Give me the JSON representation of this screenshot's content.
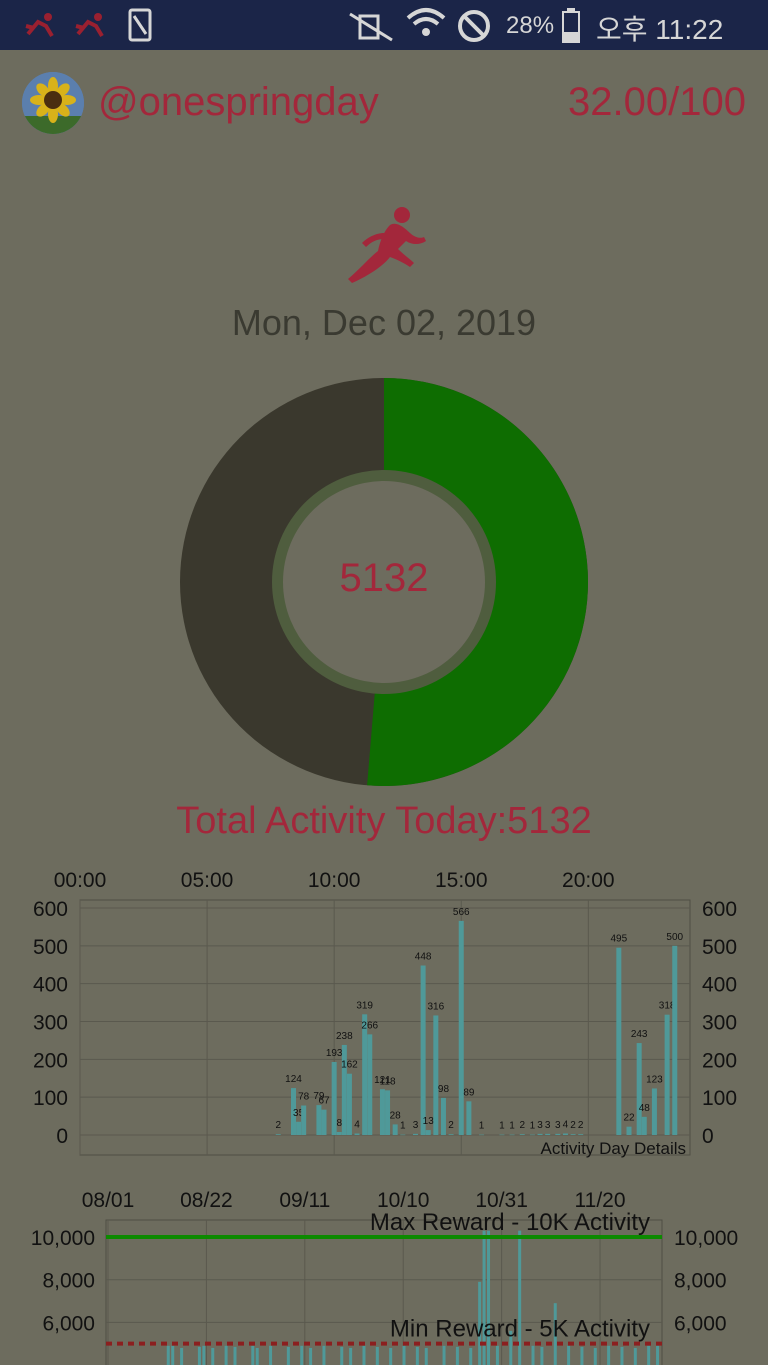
{
  "status_bar": {
    "battery": "28%",
    "time": "오후 11:22"
  },
  "profile": {
    "username": "@onespringday",
    "score": "32.00/100"
  },
  "date": "Mon, Dec 02, 2019",
  "donut": {
    "center_value": "5132",
    "activity": 5132,
    "goal": 10000,
    "colors": {
      "progress": "#0e6d01",
      "remaining": "#3a382d",
      "ring": "#4f5d3e"
    }
  },
  "total_label": "Total Activity Today:5132",
  "chart_data": [
    {
      "type": "bar",
      "caption": "Activity Day Details",
      "top_axis_labels": [
        "00:00",
        "05:00",
        "10:00",
        "15:00",
        "20:00"
      ],
      "y_ticks": [
        "0",
        "100",
        "200",
        "300",
        "400",
        "500",
        "600"
      ],
      "ylim": [
        0,
        600
      ],
      "bar_color": "#4f9999",
      "bars": [
        {
          "t": 7.8,
          "v": 2,
          "l": "2"
        },
        {
          "t": 8.4,
          "v": 124,
          "l": "124"
        },
        {
          "t": 8.6,
          "v": 35,
          "l": "35"
        },
        {
          "t": 8.8,
          "v": 78,
          "l": "78"
        },
        {
          "t": 9.4,
          "v": 79,
          "l": "79"
        },
        {
          "t": 9.6,
          "v": 67,
          "l": "67"
        },
        {
          "t": 10.0,
          "v": 193,
          "l": "193"
        },
        {
          "t": 10.2,
          "v": 8,
          "l": "8"
        },
        {
          "t": 10.4,
          "v": 238,
          "l": "238"
        },
        {
          "t": 10.6,
          "v": 162,
          "l": "162"
        },
        {
          "t": 10.9,
          "v": 4,
          "l": "4"
        },
        {
          "t": 11.2,
          "v": 319,
          "l": "319"
        },
        {
          "t": 11.4,
          "v": 266,
          "l": "266"
        },
        {
          "t": 11.9,
          "v": 121,
          "l": "121"
        },
        {
          "t": 12.1,
          "v": 118,
          "l": "118"
        },
        {
          "t": 12.4,
          "v": 28,
          "l": "28"
        },
        {
          "t": 12.7,
          "v": 1,
          "l": "1"
        },
        {
          "t": 13.2,
          "v": 3,
          "l": "3"
        },
        {
          "t": 13.5,
          "v": 448,
          "l": "448"
        },
        {
          "t": 13.7,
          "v": 13,
          "l": "13"
        },
        {
          "t": 14.0,
          "v": 316,
          "l": "316"
        },
        {
          "t": 14.3,
          "v": 98,
          "l": "98"
        },
        {
          "t": 14.6,
          "v": 2,
          "l": "2"
        },
        {
          "t": 15.0,
          "v": 566,
          "l": "566"
        },
        {
          "t": 15.3,
          "v": 89,
          "l": "89"
        },
        {
          "t": 15.8,
          "v": 1,
          "l": "1"
        },
        {
          "t": 16.6,
          "v": 1,
          "l": "1"
        },
        {
          "t": 17.0,
          "v": 1,
          "l": "1"
        },
        {
          "t": 17.4,
          "v": 2,
          "l": "2"
        },
        {
          "t": 17.8,
          "v": 1,
          "l": "1"
        },
        {
          "t": 18.1,
          "v": 3,
          "l": "3"
        },
        {
          "t": 18.4,
          "v": 3,
          "l": "3"
        },
        {
          "t": 18.8,
          "v": 3,
          "l": "3"
        },
        {
          "t": 19.1,
          "v": 4,
          "l": "4"
        },
        {
          "t": 19.4,
          "v": 2,
          "l": "2"
        },
        {
          "t": 19.7,
          "v": 2,
          "l": "2"
        },
        {
          "t": 21.2,
          "v": 495,
          "l": "495"
        },
        {
          "t": 21.6,
          "v": 22,
          "l": "22"
        },
        {
          "t": 22.0,
          "v": 243,
          "l": "243"
        },
        {
          "t": 22.2,
          "v": 48,
          "l": "48"
        },
        {
          "t": 22.6,
          "v": 123,
          "l": "123"
        },
        {
          "t": 23.1,
          "v": 318,
          "l": "318"
        },
        {
          "t": 23.4,
          "v": 500,
          "l": "500"
        }
      ]
    },
    {
      "type": "bar",
      "top_axis_labels": [
        "08/01",
        "08/22",
        "09/11",
        "10/10",
        "10/31",
        "11/20"
      ],
      "y_ticks": [
        "6,000",
        "8,000",
        "10,000"
      ],
      "ylim": [
        4000,
        10800
      ],
      "lines": [
        {
          "label": "Max Reward - 10K Activity",
          "value": 10000,
          "color": "#0c8a00",
          "style": "solid"
        },
        {
          "label": "Min Reward - 5K Activity",
          "value": 5000,
          "color": "#8b1f1f",
          "style": "dashed"
        }
      ],
      "bar_color": "#4f9999",
      "bars": [
        {
          "d": 14,
          "v": 4900
        },
        {
          "d": 15,
          "v": 4900
        },
        {
          "d": 17,
          "v": 4800
        },
        {
          "d": 21,
          "v": 4850
        },
        {
          "d": 22,
          "v": 4900
        },
        {
          "d": 24,
          "v": 4800
        },
        {
          "d": 27,
          "v": 4900
        },
        {
          "d": 29,
          "v": 4850
        },
        {
          "d": 33,
          "v": 4900
        },
        {
          "d": 34,
          "v": 4800
        },
        {
          "d": 37,
          "v": 4900
        },
        {
          "d": 41,
          "v": 4850
        },
        {
          "d": 44,
          "v": 4900
        },
        {
          "d": 46,
          "v": 4800
        },
        {
          "d": 49,
          "v": 4900
        },
        {
          "d": 53,
          "v": 4850
        },
        {
          "d": 55,
          "v": 4800
        },
        {
          "d": 58,
          "v": 4900
        },
        {
          "d": 61,
          "v": 4850
        },
        {
          "d": 64,
          "v": 4800
        },
        {
          "d": 67,
          "v": 4900
        },
        {
          "d": 70,
          "v": 4850
        },
        {
          "d": 72,
          "v": 4800
        },
        {
          "d": 76,
          "v": 4900
        },
        {
          "d": 79,
          "v": 4850
        },
        {
          "d": 82,
          "v": 4800
        },
        {
          "d": 84,
          "v": 7900
        },
        {
          "d": 85,
          "v": 10300
        },
        {
          "d": 86,
          "v": 10300
        },
        {
          "d": 88,
          "v": 4900
        },
        {
          "d": 91,
          "v": 5600
        },
        {
          "d": 93,
          "v": 10300
        },
        {
          "d": 96,
          "v": 4900
        },
        {
          "d": 98,
          "v": 4850
        },
        {
          "d": 101,
          "v": 6900
        },
        {
          "d": 104,
          "v": 4900
        },
        {
          "d": 107,
          "v": 4850
        },
        {
          "d": 110,
          "v": 4800
        },
        {
          "d": 113,
          "v": 4900
        },
        {
          "d": 116,
          "v": 4850
        },
        {
          "d": 119,
          "v": 4800
        },
        {
          "d": 122,
          "v": 4900
        },
        {
          "d": 124,
          "v": 4900
        }
      ]
    }
  ]
}
